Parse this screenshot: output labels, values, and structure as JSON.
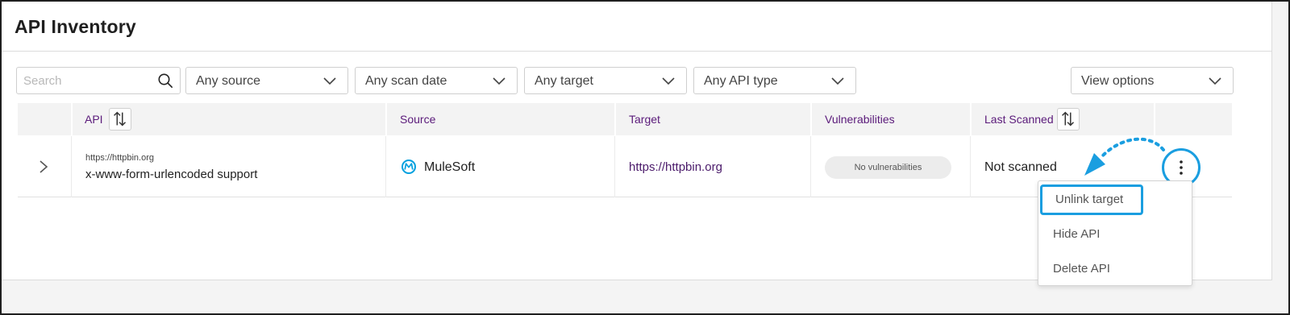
{
  "page": {
    "title": "API Inventory"
  },
  "filters": {
    "search_placeholder": "Search",
    "source": "Any source",
    "scan_date": "Any scan date",
    "target": "Any target",
    "api_type": "Any API type",
    "view_options": "View options"
  },
  "table": {
    "headers": {
      "api": "API",
      "source": "Source",
      "target": "Target",
      "vulnerabilities": "Vulnerabilities",
      "last_scanned": "Last Scanned"
    },
    "rows": [
      {
        "api_url": "https://httpbin.org",
        "api_name": "x-www-form-urlencoded support",
        "source": "MuleSoft",
        "target": "https://httpbin.org",
        "vulnerabilities": "No vulnerabilities",
        "last_scanned": "Not scanned"
      }
    ]
  },
  "row_menu": {
    "items": [
      "Unlink target",
      "Hide API",
      "Delete API"
    ]
  },
  "colors": {
    "header_text": "#5a1a7a",
    "highlight": "#1a9ee0",
    "mulesoft_blue": "#00a0df"
  }
}
